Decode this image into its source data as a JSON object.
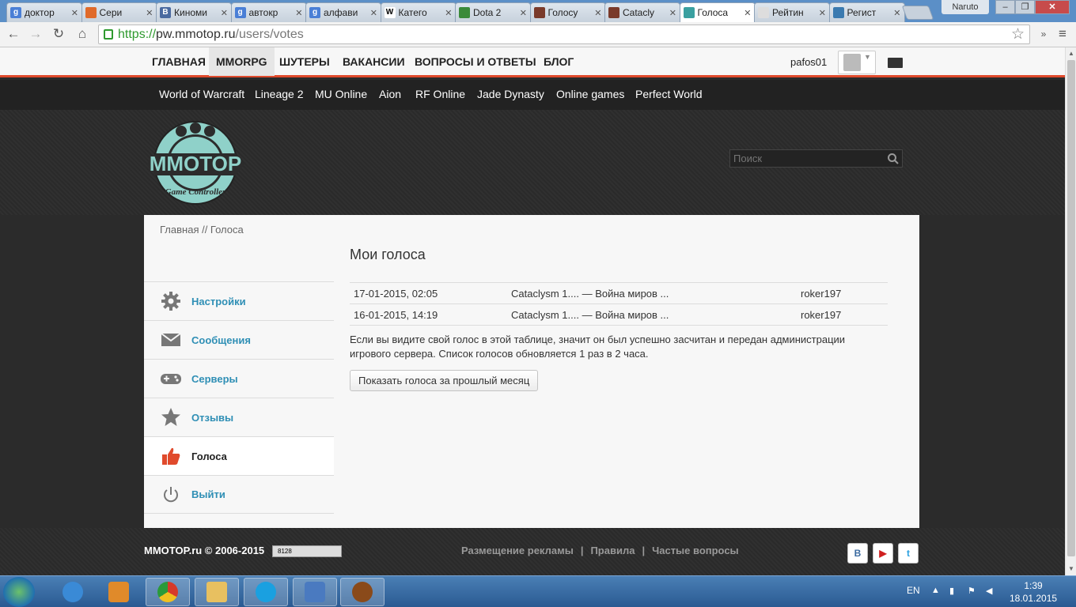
{
  "browser": {
    "tabs": [
      {
        "label": "доктор",
        "color": "#4a7fd6",
        "glyph": "g"
      },
      {
        "label": "Сери",
        "color": "#e06a2a",
        "glyph": ""
      },
      {
        "label": "Киноми",
        "color": "#4a6aa0",
        "glyph": "B"
      },
      {
        "label": "автокр",
        "color": "#4a7fd6",
        "glyph": "g"
      },
      {
        "label": "алфави",
        "color": "#4a7fd6",
        "glyph": "g"
      },
      {
        "label": "Катего",
        "color": "#ffffff",
        "glyph": "W"
      },
      {
        "label": "Dota 2",
        "color": "#3a8a3a",
        "glyph": ""
      },
      {
        "label": "Голосу",
        "color": "#7a3a2a",
        "glyph": ""
      },
      {
        "label": "Catacly",
        "color": "#7a3a2a",
        "glyph": ""
      },
      {
        "label": "Голоса",
        "color": "#3aa0a0",
        "glyph": ""
      },
      {
        "label": "Рейтин",
        "color": "#dddddd",
        "glyph": ""
      },
      {
        "label": "Регист",
        "color": "#3a7ab0",
        "glyph": ""
      }
    ],
    "window_user": "Naruto",
    "url_scheme": "https://",
    "url_host": "pw.mmotop.ru",
    "url_path": "/users/votes"
  },
  "topnav": {
    "items": [
      "ГЛАВНАЯ",
      "MMORPG",
      "ШУТЕРЫ",
      "ВАКАНСИИ",
      "ВОПРОСЫ И ОТВЕТЫ",
      "БЛОГ"
    ],
    "username": "pafos01"
  },
  "subnav": {
    "items": [
      "World of Warcraft",
      "Lineage 2",
      "MU Online",
      "Aion",
      "RF Online",
      "Jade Dynasty",
      "Online games",
      "Perfect World"
    ]
  },
  "header": {
    "logo_text": "MMOTOP",
    "logo_sub": "Game Controller",
    "search_placeholder": "Поиск"
  },
  "breadcrumb": "Главная // Голоса",
  "sidebar": {
    "items": [
      {
        "label": "Настройки",
        "icon": "gear-icon"
      },
      {
        "label": "Сообщения",
        "icon": "envelope-icon"
      },
      {
        "label": "Серверы",
        "icon": "gamepad-icon"
      },
      {
        "label": "Отзывы",
        "icon": "star-icon"
      },
      {
        "label": "Голоса",
        "icon": "thumbs-up-icon"
      },
      {
        "label": "Выйти",
        "icon": "power-icon"
      }
    ]
  },
  "main": {
    "title": "Мои голоса",
    "votes": [
      {
        "date": "17-01-2015, 02:05",
        "server": "Cataclysm 1.... — Война миров ...",
        "user": "roker197"
      },
      {
        "date": "16-01-2015, 14:19",
        "server": "Cataclysm 1.... — Война миров ...",
        "user": "roker197"
      }
    ],
    "note": "Если вы видите свой голос в этой таблице, значит он был успешно засчитан и передан администрации игрового сервера. Список голосов обновляется 1 раз в 2 часа.",
    "button_label": "Показать голоса за прошлый месяц"
  },
  "footer": {
    "copyright": "MMOTOP.ru © 2006-2015",
    "counter": "8128",
    "links": [
      "Размещение рекламы",
      "Правила",
      "Частые вопросы"
    ],
    "social": [
      "В",
      "▶",
      "t"
    ]
  },
  "taskbar": {
    "lang": "EN",
    "time": "1:39",
    "date": "18.01.2015"
  },
  "colors": {
    "accent": "#e04a2c",
    "link": "#2f8fb5",
    "active_icon": "#e04a2c",
    "logo_teal": "#8fd1c9"
  }
}
